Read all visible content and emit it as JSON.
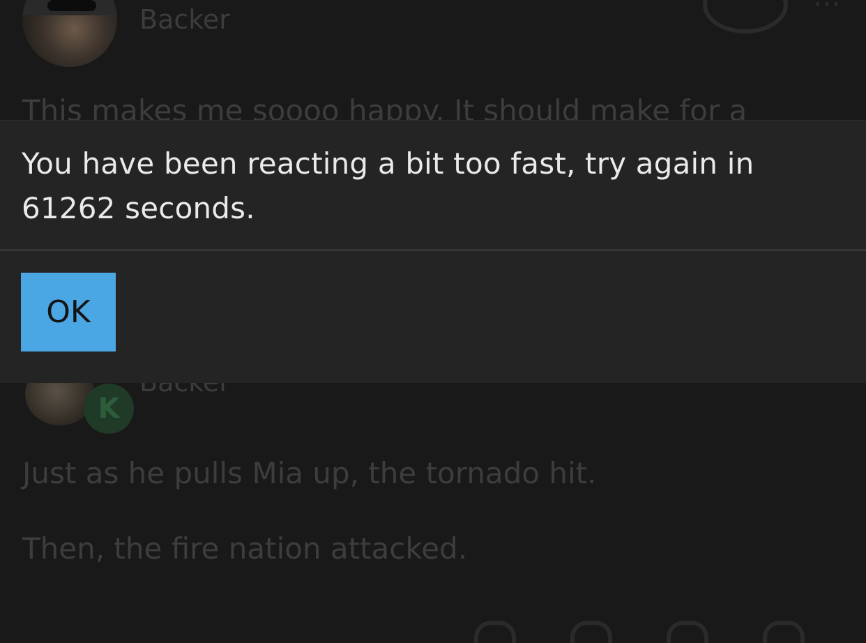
{
  "background": {
    "top_post": {
      "role": "Backer",
      "text": "This makes me soooo happy. It should make for a"
    },
    "bottom_post": {
      "role": "Backer",
      "badge": "K",
      "lines": [
        "Just as he pulls Mia up, the tornado hit.",
        "Then, the fire nation attacked."
      ]
    }
  },
  "dialog": {
    "message": "You have been reacting a bit too fast, try again in 61262 seconds.",
    "ok_label": "OK"
  },
  "colors": {
    "accent": "#4aa7e4",
    "dialog_bg": "#242424",
    "page_bg": "#191919"
  }
}
